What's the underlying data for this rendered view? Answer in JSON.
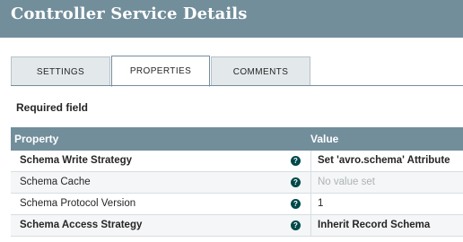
{
  "dialog": {
    "title": "Controller Service Details"
  },
  "tabs": [
    {
      "label": "SETTINGS",
      "active": false
    },
    {
      "label": "PROPERTIES",
      "active": true
    },
    {
      "label": "COMMENTS",
      "active": false
    }
  ],
  "required_label": "Required field",
  "table": {
    "columns": [
      "Property",
      "Value"
    ],
    "rows": [
      {
        "name": "Schema Write Strategy",
        "value": "Set 'avro.schema' Attribute",
        "required": true,
        "help_icon": "question-circle-icon"
      },
      {
        "name": "Schema Cache",
        "value": "No value set",
        "required": false,
        "help_icon": "question-circle-icon"
      },
      {
        "name": "Schema Protocol Version",
        "value": "1",
        "required": false,
        "help_icon": "question-circle-icon"
      },
      {
        "name": "Schema Access Strategy",
        "value": "Inherit Record Schema",
        "required": true,
        "help_icon": "question-circle-icon"
      }
    ]
  },
  "colors": {
    "header": "#728e9b",
    "help_icon": "#004849"
  }
}
